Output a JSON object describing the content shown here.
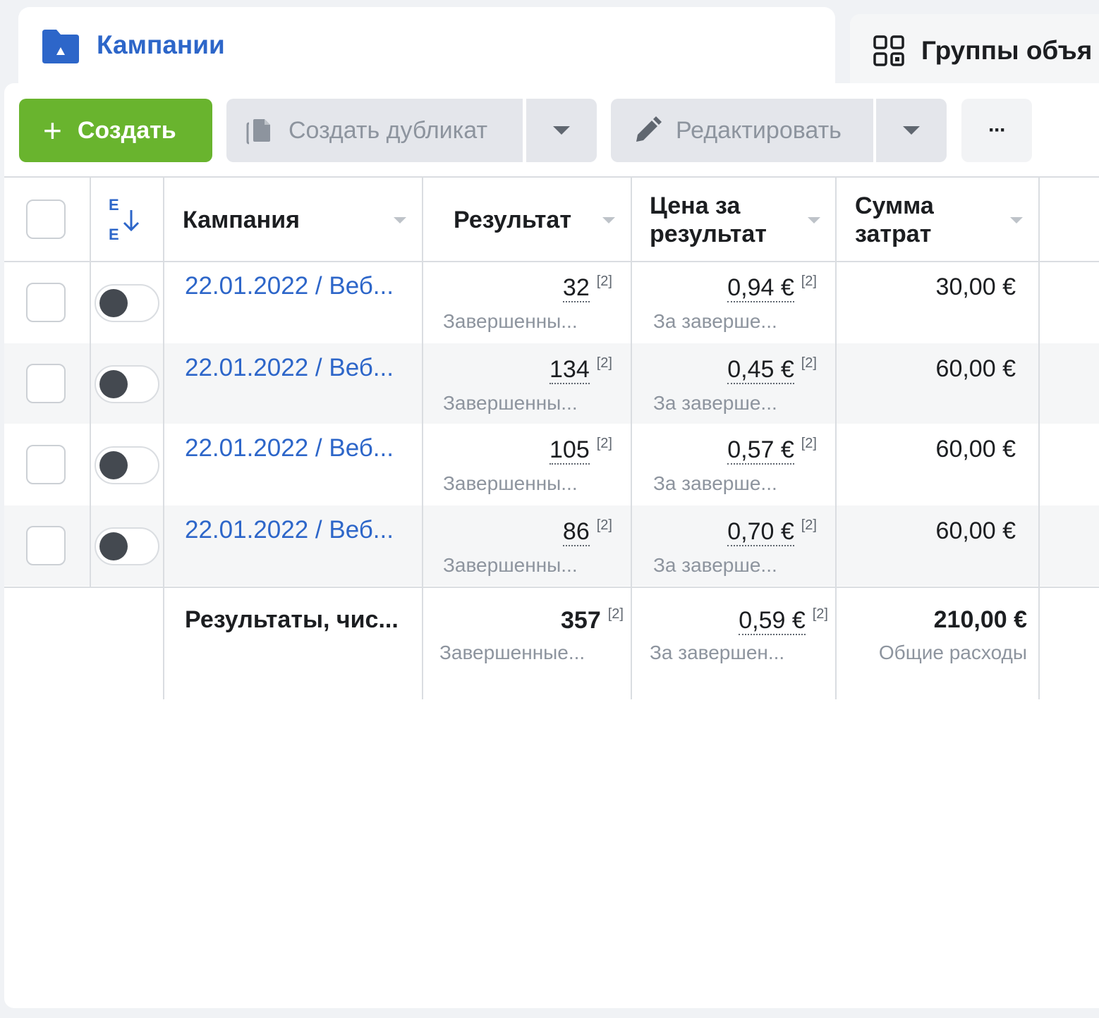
{
  "tabs": {
    "campaigns": {
      "label": "Кампании"
    },
    "adsets": {
      "label": "Группы объя"
    }
  },
  "toolbar": {
    "create_label": "Создать",
    "duplicate_label": "Создать дубликат",
    "edit_label": "Редактировать",
    "more_label": "···"
  },
  "table": {
    "headers": {
      "campaign": "Кампания",
      "result": "Результат",
      "cost_line1": "Цена за",
      "cost_line2": "результат",
      "spend_line1": "Сумма",
      "spend_line2": "затрат"
    },
    "rows": [
      {
        "name": "22.01.2022 / Веб...",
        "result": "32",
        "result_note": "[2]",
        "result_sub": "Завершенны...",
        "cost": "0,94 €",
        "cost_note": "[2]",
        "cost_sub": "За заверше...",
        "spend": "30,00 €"
      },
      {
        "name": "22.01.2022 / Веб...",
        "result": "134",
        "result_note": "[2]",
        "result_sub": "Завершенны...",
        "cost": "0,45 €",
        "cost_note": "[2]",
        "cost_sub": "За заверше...",
        "spend": "60,00 €"
      },
      {
        "name": "22.01.2022 / Веб...",
        "result": "105",
        "result_note": "[2]",
        "result_sub": "Завершенны...",
        "cost": "0,57 €",
        "cost_note": "[2]",
        "cost_sub": "За заверше...",
        "spend": "60,00 €"
      },
      {
        "name": "22.01.2022 / Веб...",
        "result": "86",
        "result_note": "[2]",
        "result_sub": "Завершенны...",
        "cost": "0,70 €",
        "cost_note": "[2]",
        "cost_sub": "За заверше...",
        "spend": "60,00 €"
      }
    ],
    "totals": {
      "label": "Результаты, чис...",
      "result": "357",
      "result_note": "[2]",
      "result_sub": "Завершенные...",
      "cost": "0,59 €",
      "cost_note": "[2]",
      "cost_sub": "За завершен...",
      "spend": "210,00 €",
      "spend_sub": "Общие расходы"
    }
  },
  "colors": {
    "accent_blue": "#2d66c9",
    "create_green": "#69b42e",
    "toggle_knob": "#444950"
  }
}
